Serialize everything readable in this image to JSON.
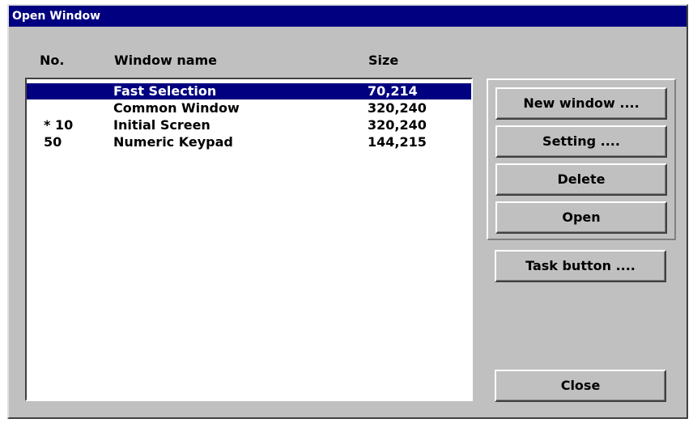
{
  "window": {
    "title": "Open Window"
  },
  "columns": {
    "no": "No.",
    "name": "Window name",
    "size": "Size"
  },
  "rows": [
    {
      "no": "",
      "name": "Fast Selection",
      "size": "70,214",
      "selected": true
    },
    {
      "no": "",
      "name": "Common Window",
      "size": "320,240",
      "selected": false
    },
    {
      "no": "* 10",
      "name": "Initial Screen",
      "size": "320,240",
      "selected": false
    },
    {
      "no": "50",
      "name": "Numeric Keypad",
      "size": "144,215",
      "selected": false
    }
  ],
  "buttons": {
    "new_window": "New window ....",
    "setting": "Setting ....",
    "delete": "Delete",
    "open": "Open",
    "task_button": "Task button ....",
    "close": "Close"
  },
  "colors": {
    "title_bar": "#000080",
    "selection": "#000080",
    "face": "#c0c0c0"
  }
}
